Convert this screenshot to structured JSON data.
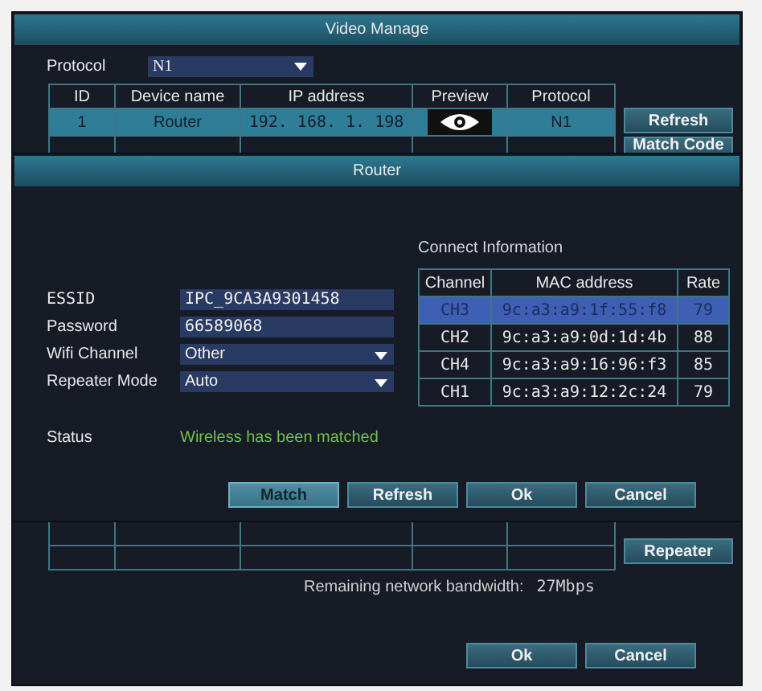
{
  "video_manage": {
    "title": "Video Manage",
    "protocol": {
      "label": "Protocol",
      "value": "N1"
    },
    "table": {
      "columns": [
        "ID",
        "Device name",
        "IP address",
        "Preview",
        "Protocol"
      ],
      "rows": [
        {
          "id": "1",
          "device_name": "Router",
          "ip_address": "192. 168. 1. 198",
          "protocol": "N1",
          "selected": true
        }
      ]
    },
    "side_buttons": [
      "Refresh",
      "Match Code",
      "Repeater"
    ],
    "bandwidth": {
      "label": "Remaining network bandwidth:",
      "value": "27Mbps"
    },
    "buttons": [
      "Ok",
      "Cancel"
    ]
  },
  "router_dialog": {
    "title": "Router",
    "fields": [
      {
        "label": "ESSID",
        "value": "IPC_9CA3A9301458",
        "kind": "text"
      },
      {
        "label": "Password",
        "value": "66589068",
        "kind": "text"
      },
      {
        "label": "Wifi Channel",
        "value": "Other",
        "kind": "dropdown"
      },
      {
        "label": "Repeater Mode",
        "value": "Auto",
        "kind": "dropdown"
      }
    ],
    "connect_info": {
      "title": "Connect Information",
      "columns": [
        "Channel",
        "MAC address",
        "Rate"
      ],
      "rows": [
        {
          "channel": "CH3",
          "mac": "9c:a3:a9:1f:55:f8",
          "rate": "79",
          "selected": true
        },
        {
          "channel": "CH2",
          "mac": "9c:a3:a9:0d:1d:4b",
          "rate": "88",
          "selected": false
        },
        {
          "channel": "CH4",
          "mac": "9c:a3:a9:16:96:f3",
          "rate": "85",
          "selected": false
        },
        {
          "channel": "CH1",
          "mac": "9c:a3:a9:12:2c:24",
          "rate": "79",
          "selected": false
        }
      ]
    },
    "status": {
      "label": "Status",
      "value": "Wireless has been matched"
    },
    "buttons": [
      {
        "label": "Match",
        "disabled": true
      },
      {
        "label": "Refresh",
        "disabled": false
      },
      {
        "label": "Ok",
        "disabled": false
      },
      {
        "label": "Cancel",
        "disabled": false
      }
    ]
  }
}
